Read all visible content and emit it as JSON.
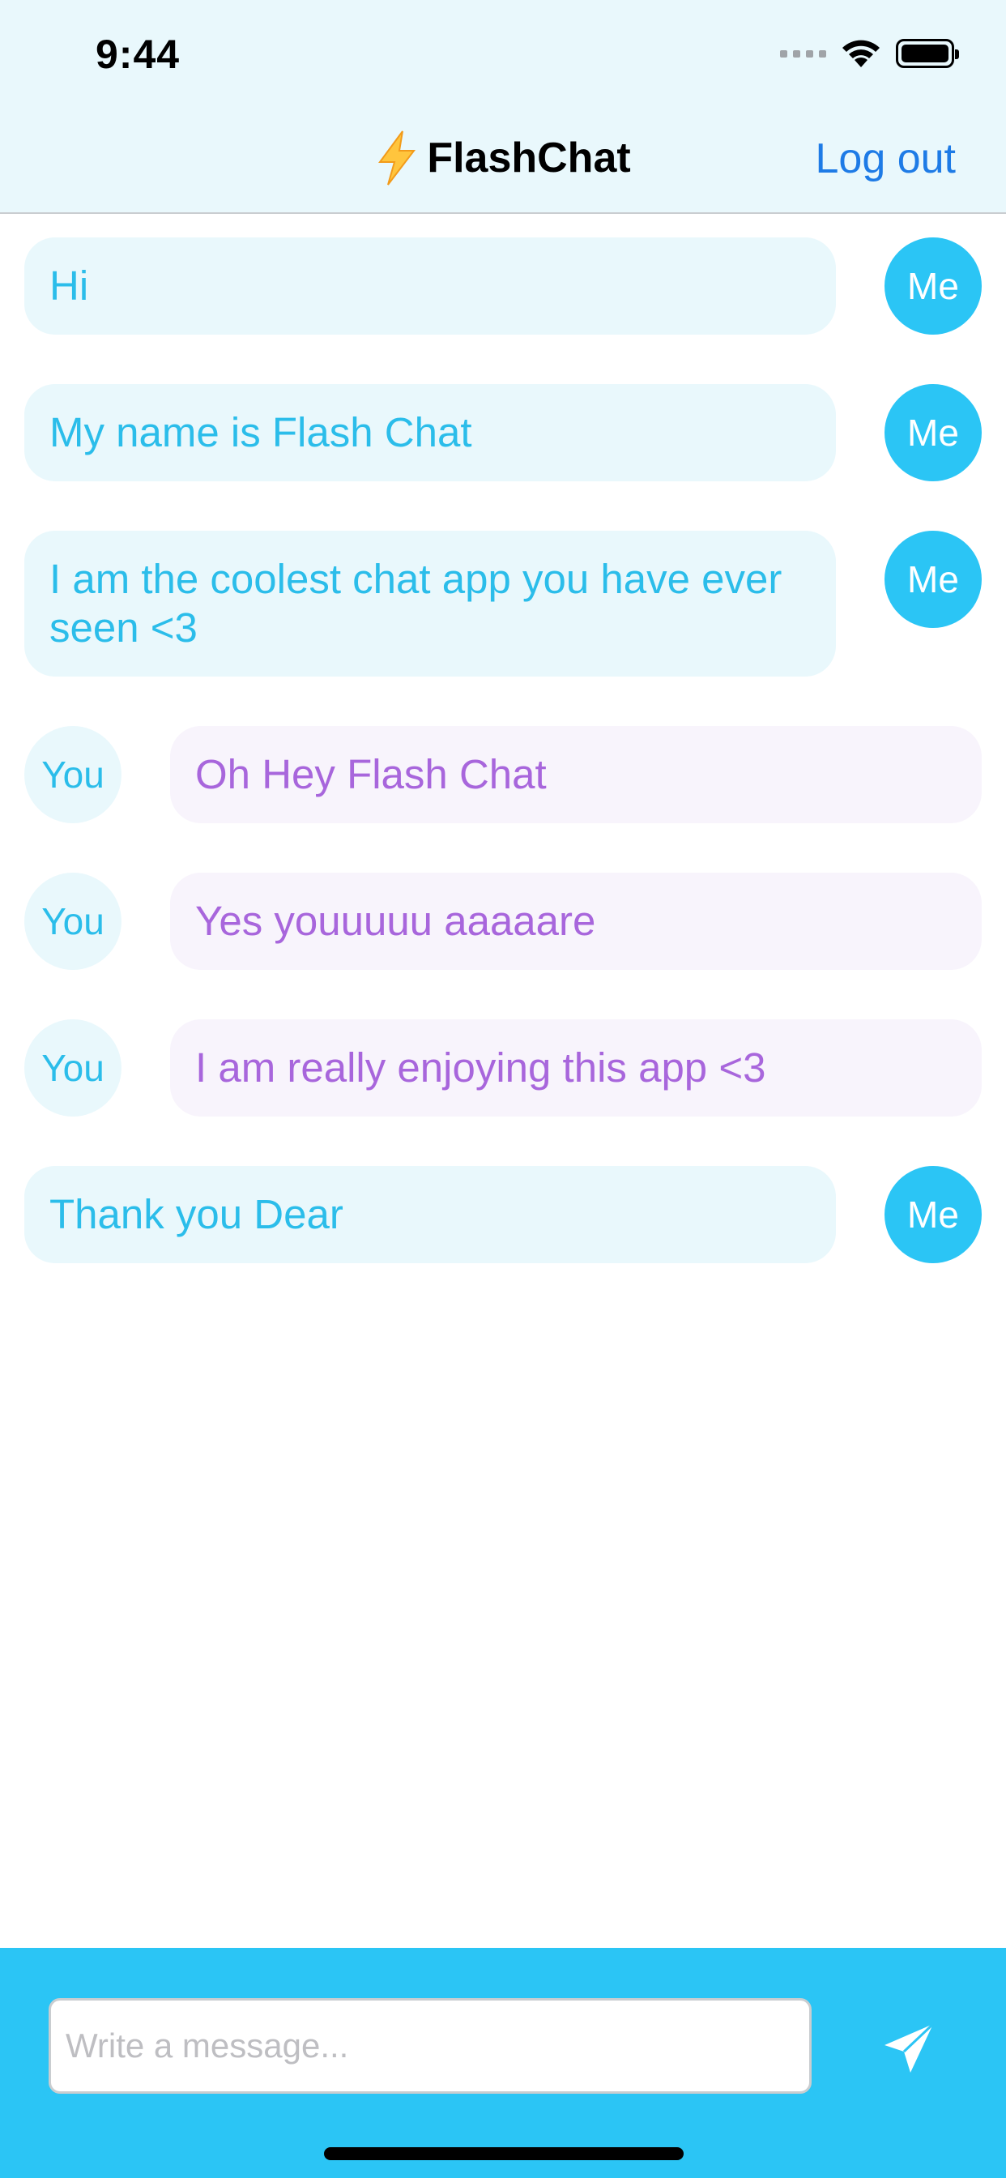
{
  "status_bar": {
    "time": "9:44",
    "icons": [
      "signal-icon",
      "wifi-icon",
      "battery-icon"
    ]
  },
  "nav": {
    "title": "FlashChat",
    "title_icon": "lightning-bolt-icon",
    "logout_label": "Log out"
  },
  "colors": {
    "me_bubble_bg": "#E9F8FC",
    "me_text": "#2BBDEA",
    "me_avatar_bg": "#2BC5F5",
    "you_bubble_bg": "#F8F4FC",
    "you_text": "#A866DC",
    "link": "#1E7BE6",
    "composer_bg": "#2BC5F5"
  },
  "messages": [
    {
      "sender": "me",
      "avatar_label": "Me",
      "text": "Hi"
    },
    {
      "sender": "me",
      "avatar_label": "Me",
      "text": "My name is Flash Chat"
    },
    {
      "sender": "me",
      "avatar_label": "Me",
      "text": "I am the coolest chat app you have ever seen <3"
    },
    {
      "sender": "you",
      "avatar_label": "You",
      "text": "Oh Hey Flash Chat"
    },
    {
      "sender": "you",
      "avatar_label": "You",
      "text": "Yes youuuuu aaaaare"
    },
    {
      "sender": "you",
      "avatar_label": "You",
      "text": "I am really enjoying this app <3"
    },
    {
      "sender": "me",
      "avatar_label": "Me",
      "text": "Thank you Dear"
    }
  ],
  "composer": {
    "value": "",
    "placeholder": "Write a message...",
    "send_icon": "paper-plane-icon"
  }
}
